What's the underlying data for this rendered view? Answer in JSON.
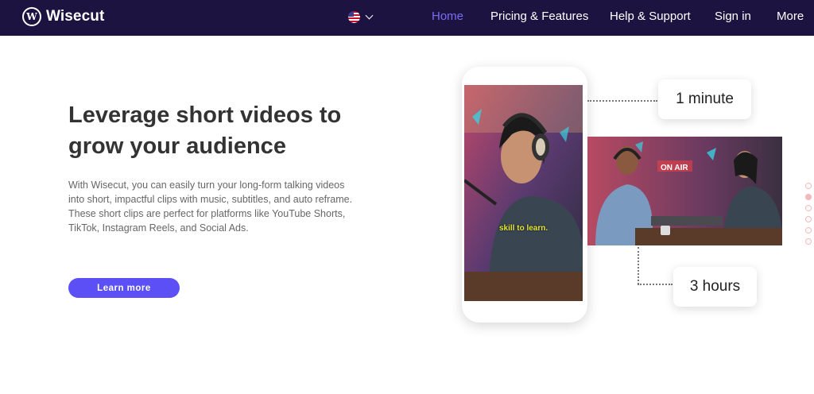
{
  "nav": {
    "logo_mark": "W",
    "logo_text": "Wisecut",
    "language_flag": "us-flag-icon",
    "items": [
      {
        "label": "Home",
        "active": true
      },
      {
        "label": "Pricing & Features",
        "active": false
      },
      {
        "label": "Help & Support",
        "active": false
      },
      {
        "label": "Sign in",
        "active": false
      },
      {
        "label": "More",
        "active": false
      }
    ]
  },
  "hero": {
    "title": "Leverage short videos to grow your audience",
    "description": "With Wisecut, you can easily turn your long-form talking videos into short, impactful clips with music, subtitles, and auto reframe. These short clips are perfect for platforms like YouTube Shorts, TikTok, Instagram Reels, and Social Ads.",
    "cta_label": "Learn more"
  },
  "illustration": {
    "short_clip_caption": "skill to learn.",
    "sign_text": "ON AIR",
    "short_duration": "1 minute",
    "long_duration": "3 hours"
  },
  "pager": {
    "count": 6,
    "active_index": 1
  },
  "colors": {
    "nav_bg": "#1c1340",
    "accent": "#5b4ff5",
    "active_link": "#7a6cf5",
    "title": "#333333",
    "body_text": "#666666"
  }
}
